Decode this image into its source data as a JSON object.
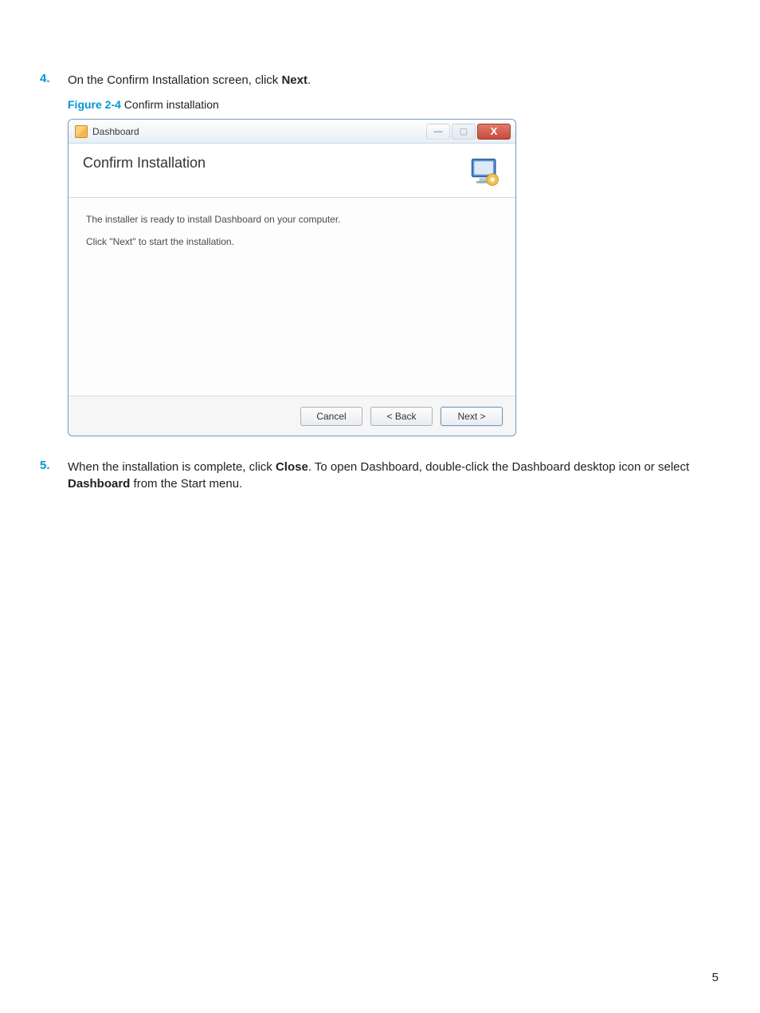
{
  "steps": {
    "s4": {
      "num": "4.",
      "text_before": "On the Confirm Installation screen, click ",
      "bold": "Next",
      "text_after": "."
    },
    "s5": {
      "num": "5.",
      "text_before": "When the installation is complete, click ",
      "bold1": "Close",
      "mid": ". To open Dashboard, double-click the Dashboard desktop icon or select ",
      "bold2": "Dashboard",
      "text_after": " from the Start menu."
    }
  },
  "figure": {
    "label": "Figure 2-4",
    "title": "  Confirm installation"
  },
  "installer": {
    "title": "Dashboard",
    "header": "Confirm Installation",
    "body_line1": "The installer is ready to install Dashboard on your computer.",
    "body_line2": "Click \"Next\" to start the installation.",
    "buttons": {
      "cancel": "Cancel",
      "back": "< Back",
      "next": "Next >"
    },
    "win_controls": {
      "min": "—",
      "max": "▢",
      "close": "X"
    }
  },
  "page_number": "5"
}
